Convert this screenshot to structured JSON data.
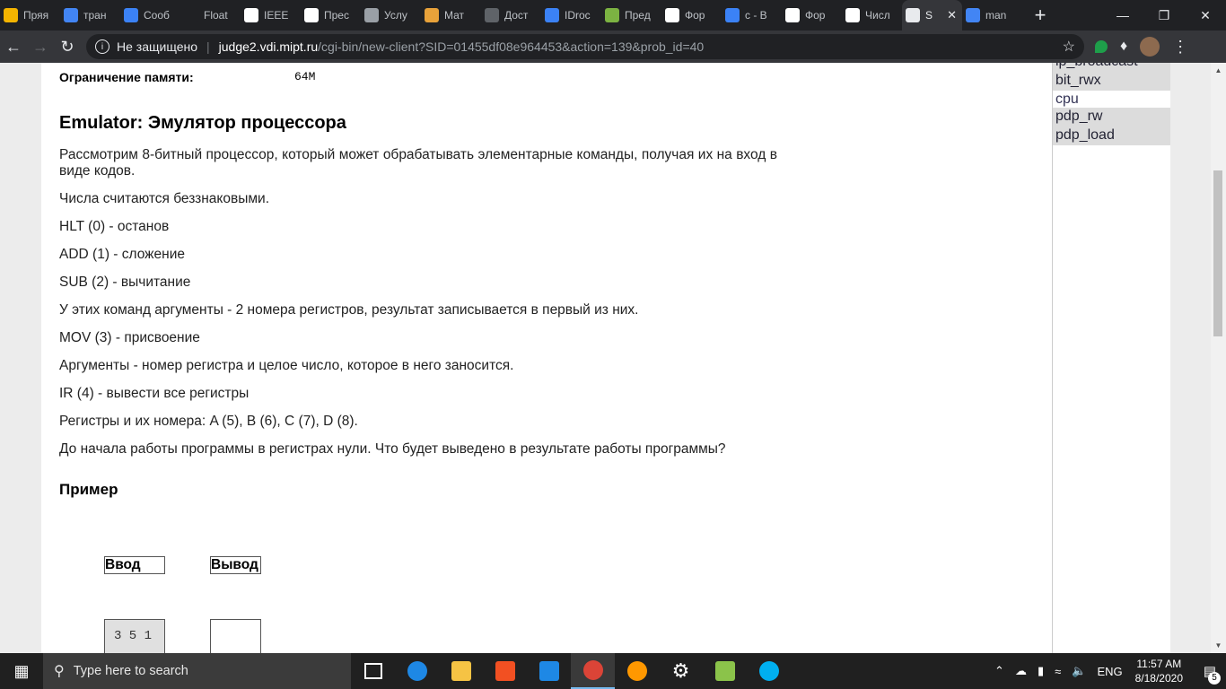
{
  "browser": {
    "tabs": [
      {
        "label": "Пряя",
        "icon": "bookmark-tab-icon",
        "color": "#f4b400"
      },
      {
        "label": "тран",
        "icon": "google-icon",
        "color": "#4285f4"
      },
      {
        "label": "Сооб",
        "icon": "chat-icon",
        "color": "#3b82f6"
      },
      {
        "label": "Float",
        "icon": "blank-tab-icon",
        "color": "#202124"
      },
      {
        "label": "IEEE",
        "icon": "wikipedia-icon",
        "color": "#ffffff"
      },
      {
        "label": "Прес",
        "icon": "doc-icon",
        "color": "#ffffff"
      },
      {
        "label": "Услу",
        "icon": "globe-icon",
        "color": "#9aa0a6"
      },
      {
        "label": "Мат",
        "icon": "m-logo-icon",
        "color": "#e8a23a"
      },
      {
        "label": "Дост",
        "icon": "globe-icon",
        "color": "#5f6368"
      },
      {
        "label": "IDroc",
        "icon": "people-icon",
        "color": "#3b82f6"
      },
      {
        "label": "Пред",
        "icon": "book-icon",
        "color": "#7cb342"
      },
      {
        "label": "Фор",
        "icon": "form-icon",
        "color": "#ffffff"
      },
      {
        "label": "c - B",
        "icon": "stack-icon",
        "color": "#3b82f6"
      },
      {
        "label": "Фор",
        "icon": "form-icon",
        "color": "#ffffff"
      },
      {
        "label": "Числ",
        "icon": "wikipedia-icon",
        "color": "#ffffff"
      },
      {
        "label": "S",
        "icon": "globe-icon",
        "color": "#e8eaed",
        "active": true
      },
      {
        "label": "man",
        "icon": "google-icon",
        "color": "#4285f4"
      }
    ],
    "new_tab": "+",
    "security_label": "Не защищено",
    "url_host": "judge2.vdi.mipt.ru",
    "url_path": "/cgi-bin/new-client?SID=01455df08e964453&action=139&prob_id=40"
  },
  "problem": {
    "memory_label": "Ограничение памяти:",
    "memory_value": "64M",
    "title": "Emulator: Эмулятор процессора",
    "paragraphs": [
      "Рассмотрим 8-битный процессор, который может обрабатывать элементарные команды, получая их на вход в виде кодов.",
      "Числа считаются беззнаковыми.",
      "HLT (0) - останов",
      "ADD (1) - сложение",
      "SUB (2) - вычитание",
      "У этих команд аргументы - 2 номера регистров, результат записывается в первый из них.",
      "MOV (3) - присвоение",
      "Аргументы - номер регистра и целое число, которое в него заносится.",
      "IR (4) - вывести все регистры",
      "Регистры и их номера: A (5), B (6), C (7), D (8).",
      "До начала работы программы в регистрах нули. Что будет выведено в результате работы программы?"
    ],
    "example_heading": "Пример",
    "input_header": "Ввод",
    "output_header": "Вывод",
    "input_value": "3 5 1",
    "output_value": ""
  },
  "sidebar": {
    "items": [
      {
        "label": "ip_broadcast"
      },
      {
        "label": "bit_rwx"
      },
      {
        "label": "cpu",
        "current": true
      },
      {
        "label": "pdp_rw"
      },
      {
        "label": "pdp_load"
      }
    ]
  },
  "taskbar": {
    "search_placeholder": "Type here to search",
    "language": "ENG",
    "time": "11:57 AM",
    "date": "8/18/2020",
    "notification_count": "5"
  }
}
